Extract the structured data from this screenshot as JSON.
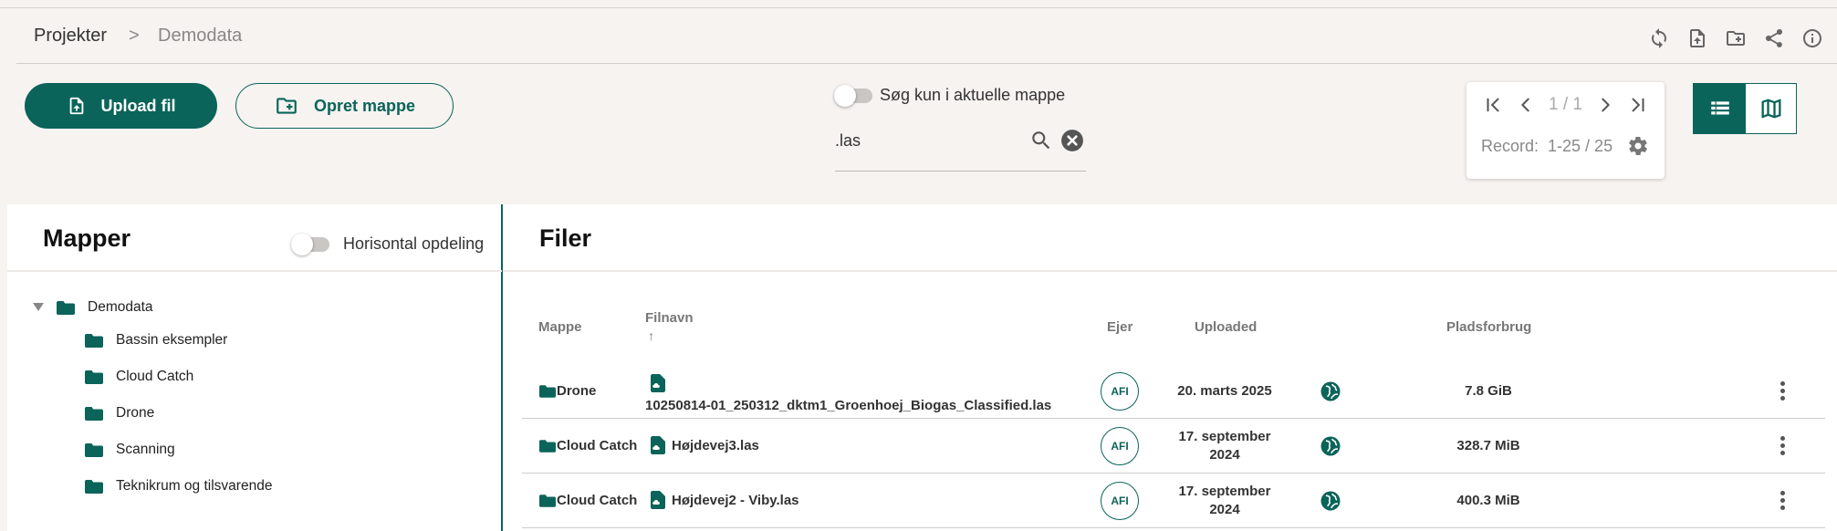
{
  "breadcrumb": {
    "root": "Projekter",
    "separator": ">",
    "current": "Demodata"
  },
  "toolbar_icons": [
    "refresh-icon",
    "upload-file-icon",
    "new-folder-icon",
    "share-icon",
    "info-icon"
  ],
  "actions": {
    "upload": "Upload fil",
    "create_folder": "Opret mappe"
  },
  "search": {
    "toggle_label": "Søg kun i aktuelle mappe",
    "value": ".las"
  },
  "pager": {
    "page": "1 / 1",
    "record_label": "Record:",
    "record_range": "1-25 / 25"
  },
  "folders_panel": {
    "title": "Mapper",
    "toggle_label": "Horisontal opdeling",
    "root": "Demodata",
    "children": [
      "Bassin eksempler",
      "Cloud Catch",
      "Drone",
      "Scanning",
      "Teknikrum og tilsvarende"
    ]
  },
  "files_panel": {
    "title": "Filer",
    "columns": {
      "folder": "Mappe",
      "name": "Filnavn",
      "sort_arrow": "↑",
      "owner": "Ejer",
      "uploaded": "Uploaded",
      "size": "Pladsforbrug"
    },
    "rows": [
      {
        "folder": "Drone",
        "name": "10250814-01_250312_dktm1_Groenhoej_Biogas_Classified.las",
        "owner": "AFI",
        "uploaded_line1": "20. marts 2025",
        "uploaded_line2": "",
        "size": "7.8 GiB"
      },
      {
        "folder": "Cloud Catch",
        "name": "Højdevej3.las",
        "owner": "AFI",
        "uploaded_line1": "17. september",
        "uploaded_line2": "2024",
        "size": "328.7 MiB"
      },
      {
        "folder": "Cloud Catch",
        "name": "Højdevej2 - Viby.las",
        "owner": "AFI",
        "uploaded_line1": "17. september",
        "uploaded_line2": "2024",
        "size": "400.3 MiB"
      }
    ]
  },
  "colors": {
    "brand": "#0b6459",
    "background": "#f6f3f1"
  }
}
